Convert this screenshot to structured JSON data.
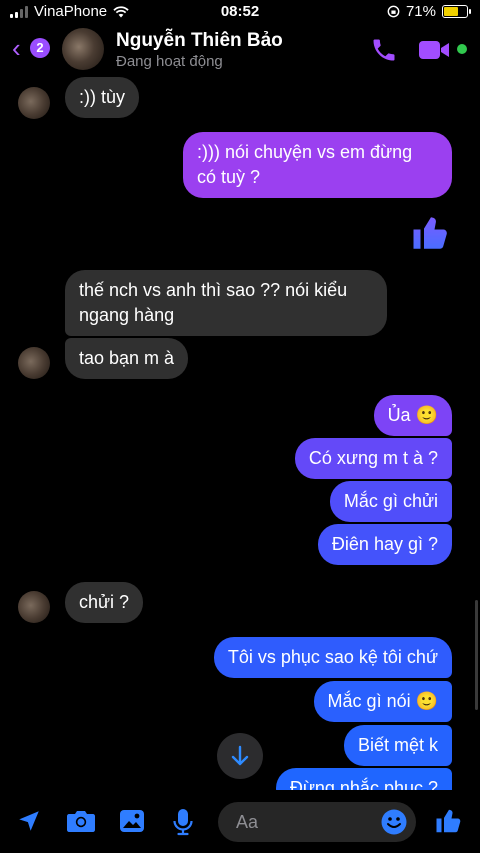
{
  "status_bar": {
    "carrier": "VinaPhone",
    "time": "08:52",
    "battery": "71%",
    "battery_level": 0.71
  },
  "header": {
    "unread_count": "2",
    "contact_name": "Nguyễn Thiên Bảo",
    "contact_status": "Đang hoạt động"
  },
  "messages": [
    {
      "dir": "in",
      "text": ":)) tùy"
    },
    {
      "dir": "out",
      "lines": [
        ":))) nói chuyện vs em đừng",
        "có tuỳ ?"
      ]
    },
    {
      "dir": "out",
      "type": "like",
      "icon": "thumbs-up-icon"
    },
    {
      "dir": "in",
      "lines": [
        "thế nch vs anh thì sao ?? nói kiểu",
        "ngang hàng"
      ]
    },
    {
      "dir": "in",
      "text": "tao bạn m à"
    },
    {
      "dir": "out",
      "text": "Ủa 🙂"
    },
    {
      "dir": "out",
      "text": "Có xưng m t à ?"
    },
    {
      "dir": "out",
      "text": "Mắc gì chửi"
    },
    {
      "dir": "out",
      "text": "Điên hay gì ?"
    },
    {
      "dir": "in",
      "text": "chửi ?"
    },
    {
      "dir": "out",
      "text": "Tôi vs phục sao kệ tôi chứ"
    },
    {
      "dir": "out",
      "text": "Mắc gì nói 🙂"
    },
    {
      "dir": "out",
      "text": "Biết mệt k"
    },
    {
      "dir": "out",
      "text": "Đừng nhắc phục ?"
    }
  ],
  "composer": {
    "placeholder": "Aa",
    "icons": [
      "location-arrow-icon",
      "camera-icon",
      "photo-icon",
      "microphone-icon",
      "emoji-icon",
      "thumbs-up-icon"
    ]
  },
  "colors": {
    "accent": "#9a4dff",
    "incoming_bubble": "#303030",
    "gradient_top": "#9a3df2",
    "gradient_bottom": "#1f6bff"
  }
}
